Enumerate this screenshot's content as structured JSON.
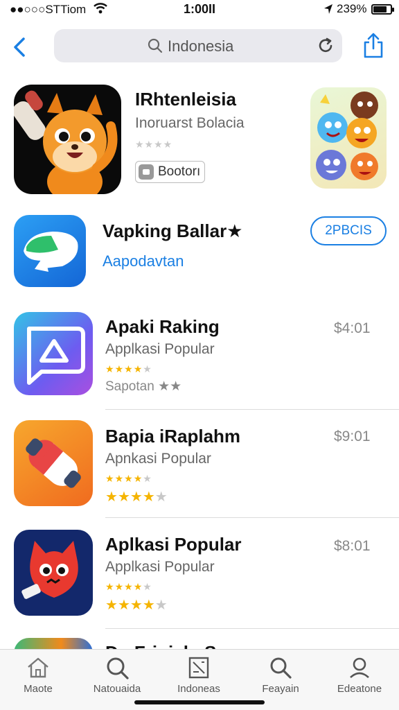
{
  "status_bar": {
    "carrier": "●●○○○STTiom",
    "time": "1:00II",
    "battery_text": "239%",
    "battery_level": 0.8,
    "wifi_icon": "wifi-icon",
    "location_icon": "location-arrow-icon"
  },
  "search": {
    "query": "Indonesia",
    "search_icon": "search-icon",
    "refresh_icon": "refresh-icon"
  },
  "nav": {
    "back_icon": "chevron-left-icon",
    "share_icon": "share-icon"
  },
  "featured": {
    "title": "IRhtenleisia",
    "subtitle": "Inoruarst Bolacia",
    "stars_text": "★★★★",
    "badge_label": "Bootorı",
    "icon": "fox-mascot-icon",
    "side_icon": "emoji-faces-icon"
  },
  "second": {
    "title": "Vapking Ballar★",
    "link": "Aapodavtan",
    "get_label": "2PBCIS",
    "icon": "chat-bubble-icon"
  },
  "list": [
    {
      "title": "Apaki Raking",
      "subtitle": "Applkasi Popular",
      "price": "$4:01",
      "rating": 4,
      "extra": "Sapotan ★★",
      "icon": "message-triangle-icon"
    },
    {
      "title": "Bapia iRaplahm",
      "subtitle": "Apnkasi Popular",
      "price": "$9:01",
      "rating": 4,
      "big_rating": 3.5,
      "icon": "pill-capsule-icon"
    },
    {
      "title": "Aplkasi Popular",
      "subtitle": "Applkasi Popular",
      "price": "$8:01",
      "rating": 4,
      "big_rating": 4,
      "icon": "red-monster-icon"
    },
    {
      "title": "Dr. Friniel · Sar",
      "icon": "partial-app-icon"
    }
  ],
  "tabs": [
    {
      "label": "Maote",
      "icon": "home-icon"
    },
    {
      "label": "Natouaida",
      "icon": "search-icon"
    },
    {
      "label": "Indoneas",
      "icon": "document-icon"
    },
    {
      "label": "Feayain",
      "icon": "magnifier-icon"
    },
    {
      "label": "Edeatone",
      "icon": "person-icon"
    }
  ],
  "colors": {
    "accent": "#1a7fe3",
    "star": "#f5b400"
  }
}
